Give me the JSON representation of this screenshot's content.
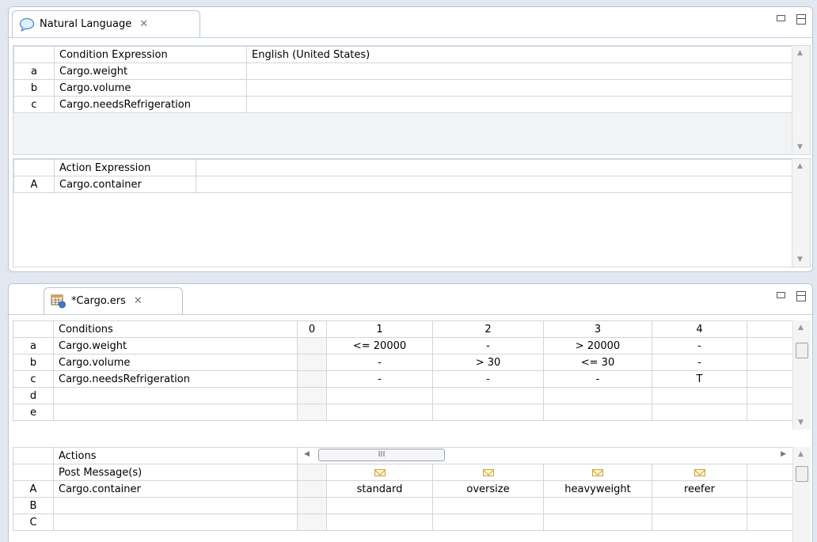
{
  "nl_panel": {
    "tab_title": "Natural Language",
    "tab_close": "✕",
    "conditions": {
      "header_expr": "Condition Expression",
      "header_lang": "English (United States)",
      "rows": [
        {
          "id": "a",
          "expr": "Cargo.weight"
        },
        {
          "id": "b",
          "expr": "Cargo.volume"
        },
        {
          "id": "c",
          "expr": "Cargo.needsRefrigeration"
        }
      ]
    },
    "actions": {
      "header_expr": "Action Expression",
      "rows": [
        {
          "id": "A",
          "expr": "Cargo.container"
        }
      ]
    }
  },
  "editor_panel": {
    "tab_title": "*Cargo.ers",
    "tab_close": "✕",
    "conditions": {
      "header": "Conditions",
      "columns": [
        "0",
        "1",
        "2",
        "3",
        "4"
      ],
      "rows": [
        {
          "id": "a",
          "expr": "Cargo.weight",
          "cells": [
            "",
            "<= 20000",
            "-",
            "> 20000",
            "-"
          ]
        },
        {
          "id": "b",
          "expr": "Cargo.volume",
          "cells": [
            "",
            "-",
            "> 30",
            "<= 30",
            "-"
          ]
        },
        {
          "id": "c",
          "expr": "Cargo.needsRefrigeration",
          "cells": [
            "",
            "-",
            "-",
            "-",
            "T"
          ]
        },
        {
          "id": "d",
          "expr": "",
          "cells": [
            "",
            "",
            "",
            "",
            ""
          ]
        },
        {
          "id": "e",
          "expr": "",
          "cells": [
            "",
            "",
            "",
            "",
            ""
          ]
        }
      ]
    },
    "hscroll_thumb": "III",
    "actions": {
      "header": "Actions",
      "post_message": "Post Message(s)",
      "rows": [
        {
          "id": "A",
          "expr": "Cargo.container",
          "cells": [
            "",
            "standard",
            "oversize",
            "heavyweight",
            "reefer"
          ]
        },
        {
          "id": "B",
          "expr": "",
          "cells": [
            "",
            "",
            "",
            "",
            ""
          ]
        },
        {
          "id": "C",
          "expr": "",
          "cells": [
            "",
            "",
            "",
            "",
            ""
          ]
        }
      ]
    }
  },
  "icons": {
    "nl_tab": "speech-bubble-icon",
    "editor_tab": "decision-table-icon",
    "post_message": "envelope-icon"
  },
  "colors": {
    "background": "#e3e8f0",
    "tab_border": "#b8c4d4",
    "grid": "#cfd6e0",
    "envelope": "#c9a43a"
  }
}
